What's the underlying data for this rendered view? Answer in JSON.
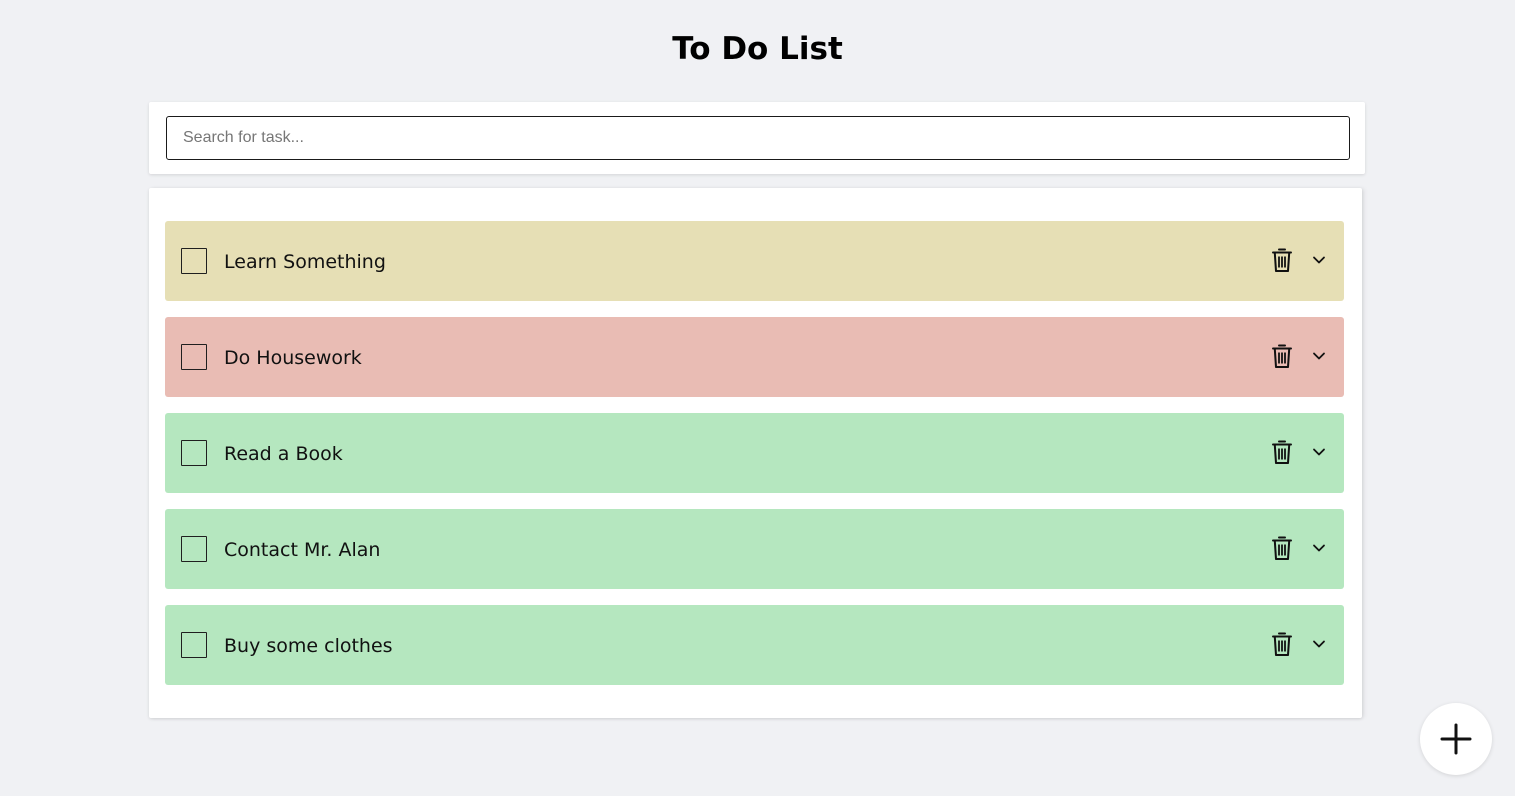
{
  "header": {
    "title": "To Do List"
  },
  "search": {
    "placeholder": "Search for task...",
    "value": ""
  },
  "tasks": [
    {
      "label": "Learn Something",
      "color": "#e6dfb5",
      "checked": false
    },
    {
      "label": "Do Housework",
      "color": "#e9bcb4",
      "checked": false
    },
    {
      "label": "Read a Book",
      "color": "#b5e7bf",
      "checked": false
    },
    {
      "label": "Contact Mr. Alan",
      "color": "#b5e7bf",
      "checked": false
    },
    {
      "label": "Buy some clothes",
      "color": "#b5e7bf",
      "checked": false
    }
  ],
  "icons": {
    "delete": "trash-icon",
    "expand": "chevron-down-icon",
    "add": "plus-icon"
  },
  "colors": {
    "background": "#f0f1f4",
    "card": "#ffffff"
  }
}
